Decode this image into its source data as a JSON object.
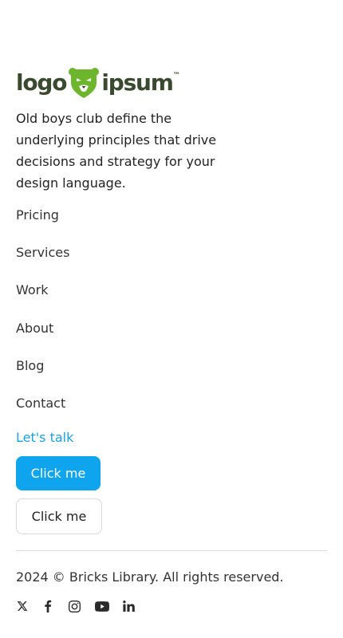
{
  "brand": {
    "logo_text_left": "logo",
    "logo_text_right": "ipsum",
    "logo_mark": "bear-head-icon",
    "logo_tm": "™",
    "colors": {
      "logo_text": "#3a4a2f",
      "logo_mark": "#6cb52d"
    }
  },
  "tagline": "Old boys club define the underlying principles that drive decisions and strategy for your design language.",
  "nav": {
    "items": [
      {
        "label": "Pricing"
      },
      {
        "label": "Services"
      },
      {
        "label": "Work"
      },
      {
        "label": "About"
      },
      {
        "label": "Blog"
      },
      {
        "label": "Contact"
      }
    ]
  },
  "cta": {
    "talk_link": "Let's talk",
    "primary_button": "Click me",
    "secondary_button": "Click me",
    "colors": {
      "link": "#1aa1e2",
      "primary": "#0ea5ee"
    }
  },
  "footer": {
    "copyright": "2024 © Bricks Library. All rights reserved."
  },
  "social": {
    "icons": [
      "x-icon",
      "facebook-icon",
      "instagram-icon",
      "youtube-icon",
      "linkedin-icon"
    ]
  }
}
